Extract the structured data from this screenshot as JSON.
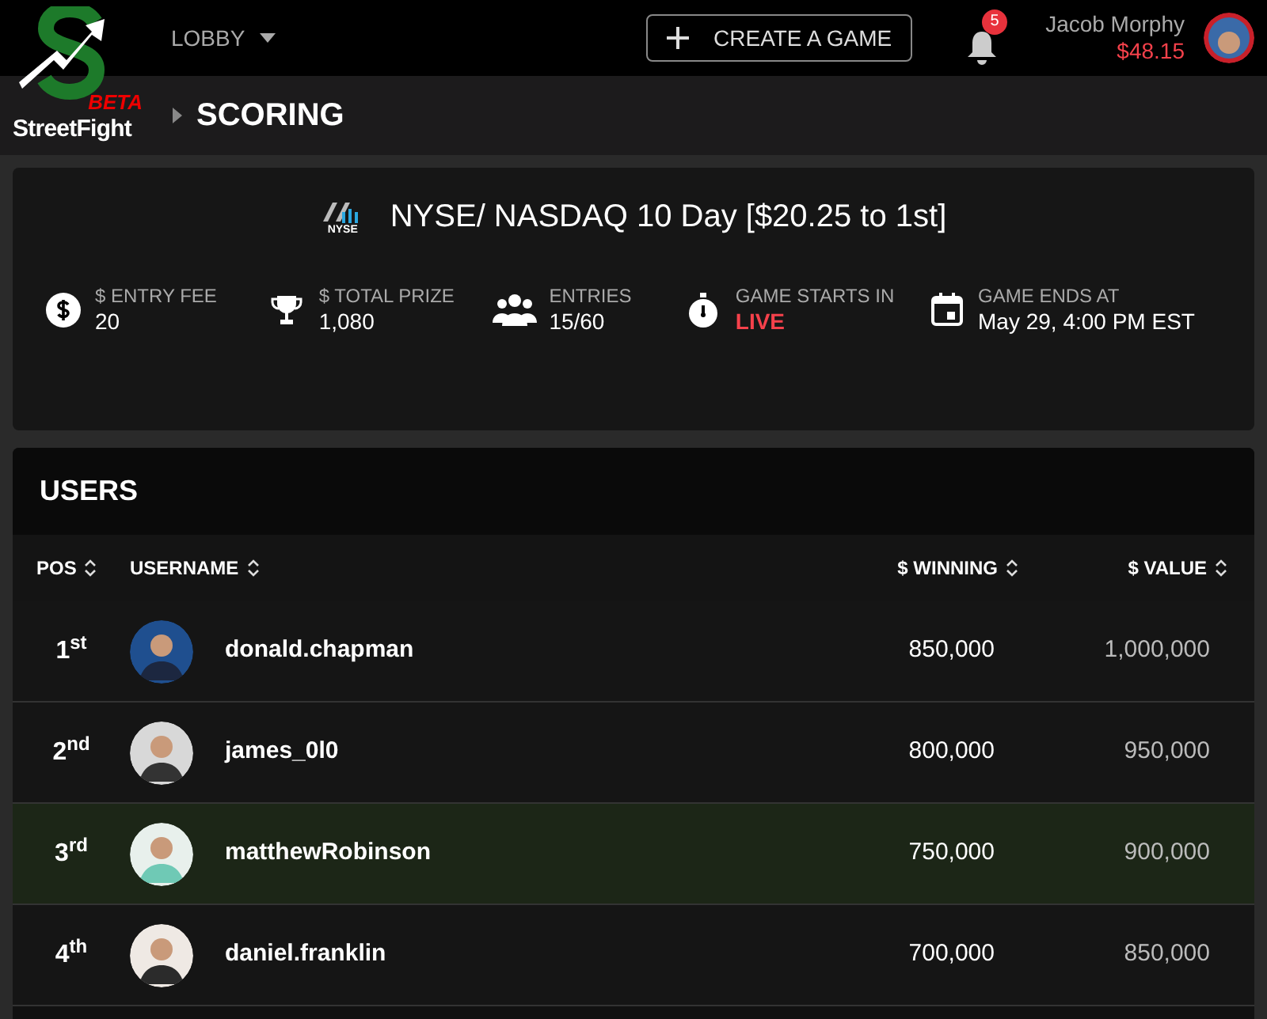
{
  "logo": {
    "beta": "BETA",
    "name": "StreetFight"
  },
  "nav": {
    "lobby": "LOBBY",
    "create_button": "CREATE A GAME",
    "notifications": "5",
    "user_name": "Jacob Morphy",
    "balance": "$48.15"
  },
  "breadcrumb": "SCORING",
  "game": {
    "exchange_label": "NYSE",
    "title": "NYSE/ NASDAQ 10 Day [$20.25 to 1st]",
    "stats": [
      {
        "kind": "dollar",
        "label": "$ ENTRY FEE",
        "value": "20",
        "live": false
      },
      {
        "kind": "trophy",
        "label": "$ TOTAL PRIZE",
        "value": "1,080",
        "live": false
      },
      {
        "kind": "people",
        "label": "ENTRIES",
        "value": "15/60",
        "live": false
      },
      {
        "kind": "timer",
        "label": "GAME STARTS IN",
        "value": "LIVE",
        "live": true
      },
      {
        "kind": "calendar",
        "label": "GAME ENDS AT",
        "value": "May 29, 4:00 PM EST",
        "live": false
      }
    ]
  },
  "users": {
    "title": "USERS",
    "columns": [
      "POS",
      "USERNAME",
      "$ WINNING",
      "$ VALUE"
    ],
    "rows": [
      {
        "pos": "1$^{st}$",
        "username": "donald.chapman",
        "winning": "850,000",
        "value": "1,000,000",
        "selected": false
      },
      {
        "pos": "2$^{nd}$",
        "username": "james_0l0",
        "winning": "800,000",
        "value": "950,000",
        "selected": false
      },
      {
        "pos": "3$^{rd}$",
        "username": "matthewRobinson",
        "winning": "750,000",
        "value": "900,000",
        "selected": true
      },
      {
        "pos": "4$^{th}$",
        "username": "daniel.franklin",
        "winning": "700,000",
        "value": "850,000",
        "selected": false
      }
    ]
  }
}
